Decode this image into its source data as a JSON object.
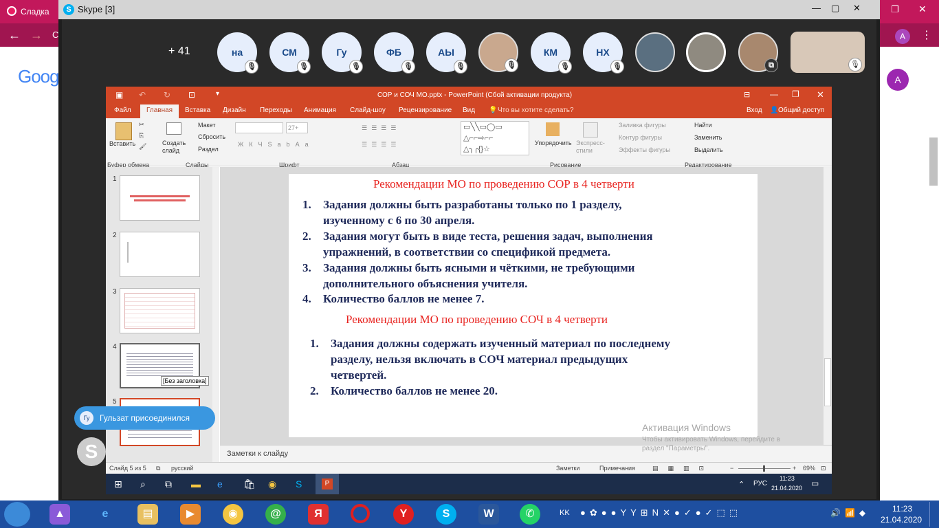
{
  "browser": {
    "tab1": "Сладка",
    "tab_initial": "С",
    "avatar": "A"
  },
  "google": {
    "logo": "Goog",
    "avatar": "A"
  },
  "skype": {
    "title": "Skype [3]",
    "more_count": "+ 41",
    "participants": [
      "на",
      "СМ",
      "Гу",
      "ФБ",
      "АЫ",
      "КМ",
      "НХ"
    ],
    "toast": {
      "avatar": "Гу",
      "text": "Гульзат присоединился"
    }
  },
  "ppt": {
    "title": "СОР и СОЧ МО.pptx - PowerPoint (Сбой активации продукта)",
    "menu": [
      "Файл",
      "Главная",
      "Вставка",
      "Дизайн",
      "Переходы",
      "Анимация",
      "Слайд-шоу",
      "Рецензирование",
      "Вид"
    ],
    "tell_me": "Что вы хотите сделать?",
    "signin": "Вход",
    "share": "Общий доступ",
    "ribbon": {
      "paste": "Вставить",
      "create_slide": "Создать слайд",
      "layout": "Макет",
      "reset": "Сбросить",
      "section": "Раздел",
      "font_size": "27+",
      "arrange": "Упорядочить",
      "quick_styles": "Экспресс-стили",
      "shape_fill": "Заливка фигуры",
      "shape_outline": "Контур фигуры",
      "shape_effects": "Эффекты фигуры",
      "find": "Найти",
      "replace": "Заменить",
      "select": "Выделить",
      "groups": [
        "Буфер обмена",
        "Слайды",
        "Шрифт",
        "Абзац",
        "Рисование",
        "Редактирование"
      ]
    },
    "thumb_numbers": [
      "1",
      "2",
      "3",
      "4",
      "5"
    ],
    "thumb_tooltip": "[Без заголовка]",
    "slide": {
      "heading1": "Рекомендации МО по проведению СОР в 4 четверти",
      "list1": [
        {
          "n": "1.",
          "line1": "Задания должны быть разработаны только по 1 разделу,",
          "line2": "изученному с 6 по 30 апреля."
        },
        {
          "n": "2.",
          "line1": "Задания могут быть в виде теста, решения задач, выполнения",
          "line2": "упражнений, в соответствии со спецификой предмета."
        },
        {
          "n": "3.",
          "line1": "Задания должны быть ясными и чёткими, не требующими",
          "line2": "дополнительного объяснения учителя."
        },
        {
          "n": "4.",
          "line1": "Количество баллов не менее 7.",
          "line2": ""
        }
      ],
      "heading2": "Рекомендации МО по проведению СОЧ в 4 четверти",
      "list2": [
        {
          "n": "1.",
          "line1": "Задания должны содержать изученный материал по последнему",
          "line2": "разделу, нельзя включать в СОЧ материал предыдущих",
          "line3": "четвертей."
        },
        {
          "n": "2.",
          "line1": "Количество баллов не менее 20."
        }
      ]
    },
    "notes_placeholder": "Заметки к слайду",
    "status": {
      "slide": "Слайд 5 из 5",
      "lang": "русский",
      "notes": "Заметки",
      "comments": "Примечания",
      "zoom": "69%"
    },
    "activation": {
      "title": "Активация Windows",
      "line1": "Чтобы активировать Windows, перейдите в",
      "line2": "раздел \"Параметры\"."
    }
  },
  "inner_taskbar": {
    "lang": "РУС",
    "time": "11:23",
    "date": "21.04.2020"
  },
  "taskbar": {
    "lang": "KK",
    "time": "11:23",
    "date": "21.04.2020"
  }
}
